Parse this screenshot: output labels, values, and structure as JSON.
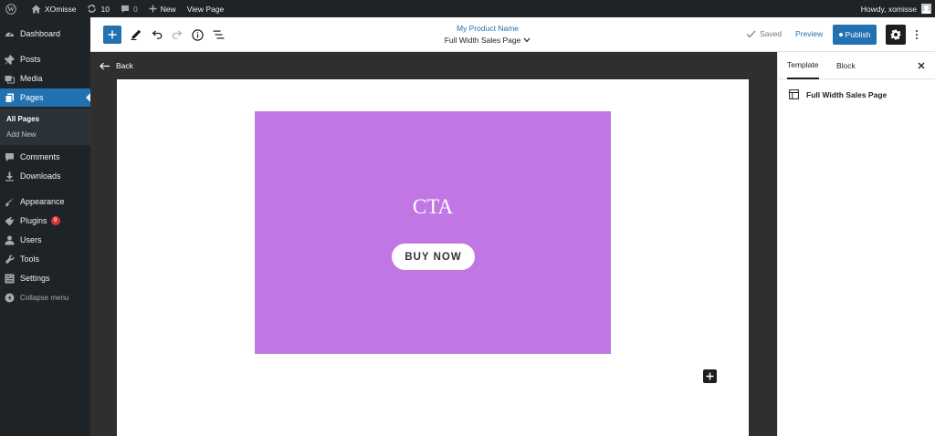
{
  "adminbar": {
    "site_name": "XOmisse",
    "updates_count": "10",
    "comments_count": "0",
    "new_label": "New",
    "view_page": "View Page",
    "howdy": "Howdy, xomisse"
  },
  "sidebar": {
    "dashboard": "Dashboard",
    "posts": "Posts",
    "media": "Media",
    "pages": "Pages",
    "all_pages": "All Pages",
    "add_new": "Add New",
    "comments": "Comments",
    "downloads": "Downloads",
    "appearance": "Appearance",
    "plugins": "Plugins",
    "plugins_badge": "9",
    "users": "Users",
    "tools": "Tools",
    "settings": "Settings",
    "collapse": "Collapse menu"
  },
  "header": {
    "product_name": "My Product Name",
    "template_name": "Full Width Sales Page",
    "saved": "Saved",
    "preview": "Preview",
    "publish": "Publish"
  },
  "canvas": {
    "back": "Back",
    "cta_title": "CTA",
    "cta_button": "BUY NOW",
    "cta_color": "#c076e3"
  },
  "panel": {
    "tab_template": "Template",
    "tab_block": "Block",
    "template_name": "Full Width Sales Page"
  }
}
